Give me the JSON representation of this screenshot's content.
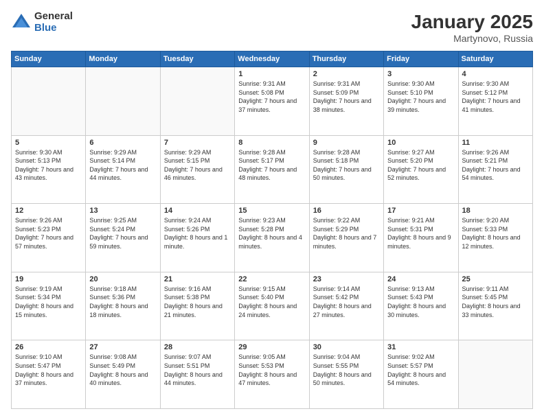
{
  "logo": {
    "general": "General",
    "blue": "Blue"
  },
  "title": "January 2025",
  "location": "Martynovo, Russia",
  "weekdays": [
    "Sunday",
    "Monday",
    "Tuesday",
    "Wednesday",
    "Thursday",
    "Friday",
    "Saturday"
  ],
  "weeks": [
    [
      {
        "day": "",
        "sunrise": "",
        "sunset": "",
        "daylight": ""
      },
      {
        "day": "",
        "sunrise": "",
        "sunset": "",
        "daylight": ""
      },
      {
        "day": "",
        "sunrise": "",
        "sunset": "",
        "daylight": ""
      },
      {
        "day": "1",
        "sunrise": "Sunrise: 9:31 AM",
        "sunset": "Sunset: 5:08 PM",
        "daylight": "Daylight: 7 hours and 37 minutes."
      },
      {
        "day": "2",
        "sunrise": "Sunrise: 9:31 AM",
        "sunset": "Sunset: 5:09 PM",
        "daylight": "Daylight: 7 hours and 38 minutes."
      },
      {
        "day": "3",
        "sunrise": "Sunrise: 9:30 AM",
        "sunset": "Sunset: 5:10 PM",
        "daylight": "Daylight: 7 hours and 39 minutes."
      },
      {
        "day": "4",
        "sunrise": "Sunrise: 9:30 AM",
        "sunset": "Sunset: 5:12 PM",
        "daylight": "Daylight: 7 hours and 41 minutes."
      }
    ],
    [
      {
        "day": "5",
        "sunrise": "Sunrise: 9:30 AM",
        "sunset": "Sunset: 5:13 PM",
        "daylight": "Daylight: 7 hours and 43 minutes."
      },
      {
        "day": "6",
        "sunrise": "Sunrise: 9:29 AM",
        "sunset": "Sunset: 5:14 PM",
        "daylight": "Daylight: 7 hours and 44 minutes."
      },
      {
        "day": "7",
        "sunrise": "Sunrise: 9:29 AM",
        "sunset": "Sunset: 5:15 PM",
        "daylight": "Daylight: 7 hours and 46 minutes."
      },
      {
        "day": "8",
        "sunrise": "Sunrise: 9:28 AM",
        "sunset": "Sunset: 5:17 PM",
        "daylight": "Daylight: 7 hours and 48 minutes."
      },
      {
        "day": "9",
        "sunrise": "Sunrise: 9:28 AM",
        "sunset": "Sunset: 5:18 PM",
        "daylight": "Daylight: 7 hours and 50 minutes."
      },
      {
        "day": "10",
        "sunrise": "Sunrise: 9:27 AM",
        "sunset": "Sunset: 5:20 PM",
        "daylight": "Daylight: 7 hours and 52 minutes."
      },
      {
        "day": "11",
        "sunrise": "Sunrise: 9:26 AM",
        "sunset": "Sunset: 5:21 PM",
        "daylight": "Daylight: 7 hours and 54 minutes."
      }
    ],
    [
      {
        "day": "12",
        "sunrise": "Sunrise: 9:26 AM",
        "sunset": "Sunset: 5:23 PM",
        "daylight": "Daylight: 7 hours and 57 minutes."
      },
      {
        "day": "13",
        "sunrise": "Sunrise: 9:25 AM",
        "sunset": "Sunset: 5:24 PM",
        "daylight": "Daylight: 7 hours and 59 minutes."
      },
      {
        "day": "14",
        "sunrise": "Sunrise: 9:24 AM",
        "sunset": "Sunset: 5:26 PM",
        "daylight": "Daylight: 8 hours and 1 minute."
      },
      {
        "day": "15",
        "sunrise": "Sunrise: 9:23 AM",
        "sunset": "Sunset: 5:28 PM",
        "daylight": "Daylight: 8 hours and 4 minutes."
      },
      {
        "day": "16",
        "sunrise": "Sunrise: 9:22 AM",
        "sunset": "Sunset: 5:29 PM",
        "daylight": "Daylight: 8 hours and 7 minutes."
      },
      {
        "day": "17",
        "sunrise": "Sunrise: 9:21 AM",
        "sunset": "Sunset: 5:31 PM",
        "daylight": "Daylight: 8 hours and 9 minutes."
      },
      {
        "day": "18",
        "sunrise": "Sunrise: 9:20 AM",
        "sunset": "Sunset: 5:33 PM",
        "daylight": "Daylight: 8 hours and 12 minutes."
      }
    ],
    [
      {
        "day": "19",
        "sunrise": "Sunrise: 9:19 AM",
        "sunset": "Sunset: 5:34 PM",
        "daylight": "Daylight: 8 hours and 15 minutes."
      },
      {
        "day": "20",
        "sunrise": "Sunrise: 9:18 AM",
        "sunset": "Sunset: 5:36 PM",
        "daylight": "Daylight: 8 hours and 18 minutes."
      },
      {
        "day": "21",
        "sunrise": "Sunrise: 9:16 AM",
        "sunset": "Sunset: 5:38 PM",
        "daylight": "Daylight: 8 hours and 21 minutes."
      },
      {
        "day": "22",
        "sunrise": "Sunrise: 9:15 AM",
        "sunset": "Sunset: 5:40 PM",
        "daylight": "Daylight: 8 hours and 24 minutes."
      },
      {
        "day": "23",
        "sunrise": "Sunrise: 9:14 AM",
        "sunset": "Sunset: 5:42 PM",
        "daylight": "Daylight: 8 hours and 27 minutes."
      },
      {
        "day": "24",
        "sunrise": "Sunrise: 9:13 AM",
        "sunset": "Sunset: 5:43 PM",
        "daylight": "Daylight: 8 hours and 30 minutes."
      },
      {
        "day": "25",
        "sunrise": "Sunrise: 9:11 AM",
        "sunset": "Sunset: 5:45 PM",
        "daylight": "Daylight: 8 hours and 33 minutes."
      }
    ],
    [
      {
        "day": "26",
        "sunrise": "Sunrise: 9:10 AM",
        "sunset": "Sunset: 5:47 PM",
        "daylight": "Daylight: 8 hours and 37 minutes."
      },
      {
        "day": "27",
        "sunrise": "Sunrise: 9:08 AM",
        "sunset": "Sunset: 5:49 PM",
        "daylight": "Daylight: 8 hours and 40 minutes."
      },
      {
        "day": "28",
        "sunrise": "Sunrise: 9:07 AM",
        "sunset": "Sunset: 5:51 PM",
        "daylight": "Daylight: 8 hours and 44 minutes."
      },
      {
        "day": "29",
        "sunrise": "Sunrise: 9:05 AM",
        "sunset": "Sunset: 5:53 PM",
        "daylight": "Daylight: 8 hours and 47 minutes."
      },
      {
        "day": "30",
        "sunrise": "Sunrise: 9:04 AM",
        "sunset": "Sunset: 5:55 PM",
        "daylight": "Daylight: 8 hours and 50 minutes."
      },
      {
        "day": "31",
        "sunrise": "Sunrise: 9:02 AM",
        "sunset": "Sunset: 5:57 PM",
        "daylight": "Daylight: 8 hours and 54 minutes."
      },
      {
        "day": "",
        "sunrise": "",
        "sunset": "",
        "daylight": ""
      }
    ]
  ]
}
